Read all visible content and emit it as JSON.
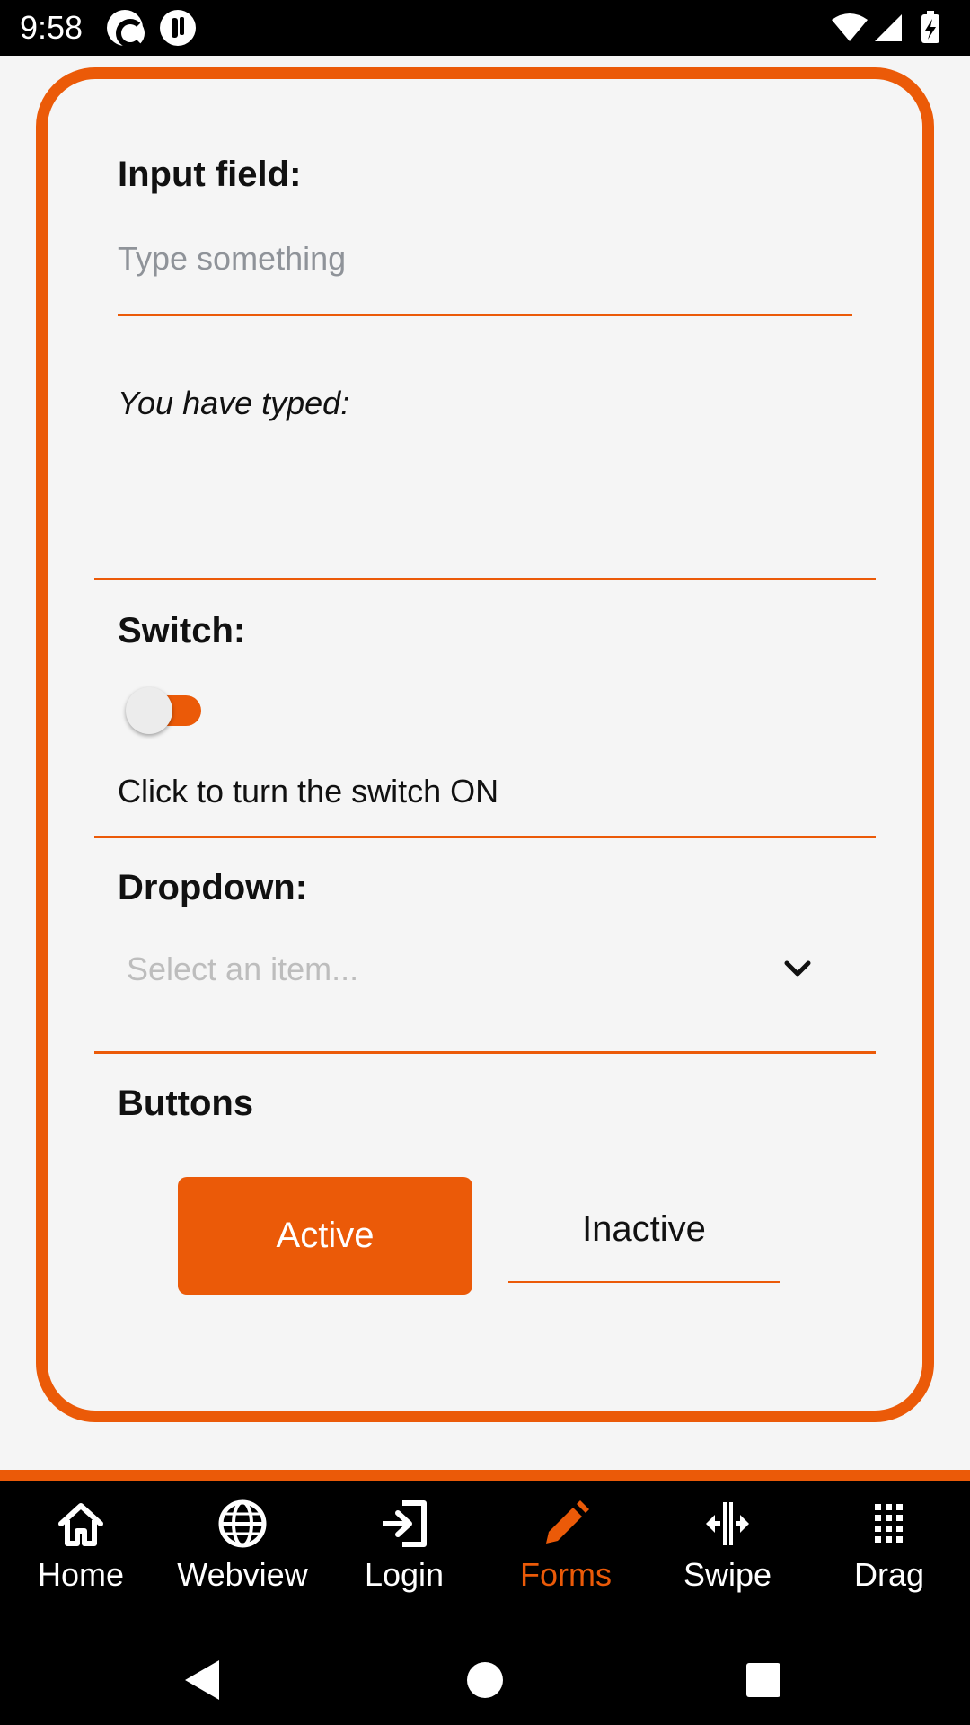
{
  "status_bar": {
    "time": "9:58"
  },
  "form": {
    "input_label": "Input field:",
    "input_placeholder": "Type something",
    "input_value": "",
    "typed_label": "You have typed:",
    "switch_label": "Switch:",
    "switch_state": false,
    "switch_text": "Click to turn the switch ON",
    "dropdown_label": "Dropdown:",
    "dropdown_placeholder": "Select an item...",
    "buttons_label": "Buttons",
    "active_button": "Active",
    "inactive_button": "Inactive"
  },
  "nav": {
    "items": [
      {
        "label": "Home",
        "icon": "home-icon"
      },
      {
        "label": "Webview",
        "icon": "globe-icon"
      },
      {
        "label": "Login",
        "icon": "login-icon"
      },
      {
        "label": "Forms",
        "icon": "pencil-icon",
        "active": true
      },
      {
        "label": "Swipe",
        "icon": "swipe-icon"
      },
      {
        "label": "Drag",
        "icon": "grid-icon"
      }
    ]
  },
  "colors": {
    "accent": "#eb5a08",
    "background": "#f5f5f5",
    "bar": "#000000"
  }
}
